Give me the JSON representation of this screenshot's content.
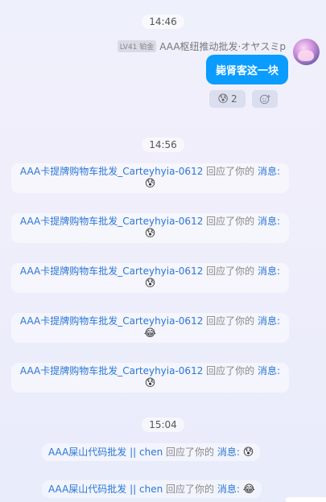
{
  "times": [
    "14:46",
    "14:56",
    "15:04"
  ],
  "self_message": {
    "level": "LV41 铂金",
    "sender": "AAA枢纽推动批发·オヤスミp",
    "text": "毙肾客这一块",
    "reaction_emoji": "😰",
    "reaction_count": "2",
    "add_reaction_icon": "add-emoji-icon"
  },
  "notices": [
    {
      "user": "AAA卡提牌购物车批发_Carteyhyia-0612",
      "action": "回应了你的",
      "msg_link": "消息:",
      "emoji": "😰"
    },
    {
      "user": "AAA卡提牌购物车批发_Carteyhyia-0612",
      "action": "回应了你的",
      "msg_link": "消息:",
      "emoji": "😰"
    },
    {
      "user": "AAA卡提牌购物车批发_Carteyhyia-0612",
      "action": "回应了你的",
      "msg_link": "消息:",
      "emoji": "😰"
    },
    {
      "user": "AAA卡提牌购物车批发_Carteyhyia-0612",
      "action": "回应了你的",
      "msg_link": "消息:",
      "emoji": "😂"
    },
    {
      "user": "AAA卡提牌购物车批发_Carteyhyia-0612",
      "action": "回应了你的",
      "msg_link": "消息:",
      "emoji": "😰"
    }
  ],
  "notices2": [
    {
      "user": "AAA屎山代码批发 || chen",
      "action": "回应了你的",
      "msg_link": "消息:",
      "emoji": "😰"
    },
    {
      "user": "AAA屎山代码批发 || chen",
      "action": "回应了你的",
      "msg_link": "消息:",
      "emoji": "😂"
    }
  ]
}
